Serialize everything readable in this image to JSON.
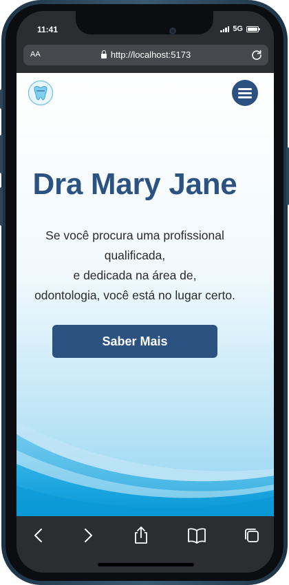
{
  "status_bar": {
    "time": "11:41",
    "network": "5G"
  },
  "browser": {
    "aa_label": "AA",
    "url": "http://localhost:5173"
  },
  "page": {
    "logo_icon": "tooth-icon",
    "menu_icon": "hamburger-menu-icon",
    "hero": {
      "title": "Dra Mary Jane",
      "text_lines": [
        "Se você procura uma profissional",
        "qualificada,",
        "e dedicada na área de,",
        "odontologia, você está no lugar certo."
      ],
      "button_label": "Saber Mais"
    }
  },
  "toolbar": {
    "icons": [
      "back-icon",
      "forward-icon",
      "share-icon",
      "bookmarks-icon",
      "tabs-icon"
    ]
  },
  "colors": {
    "accent": "#2b5281",
    "wave": "#1aa3d9",
    "browser_chrome": "#2b2d31"
  }
}
